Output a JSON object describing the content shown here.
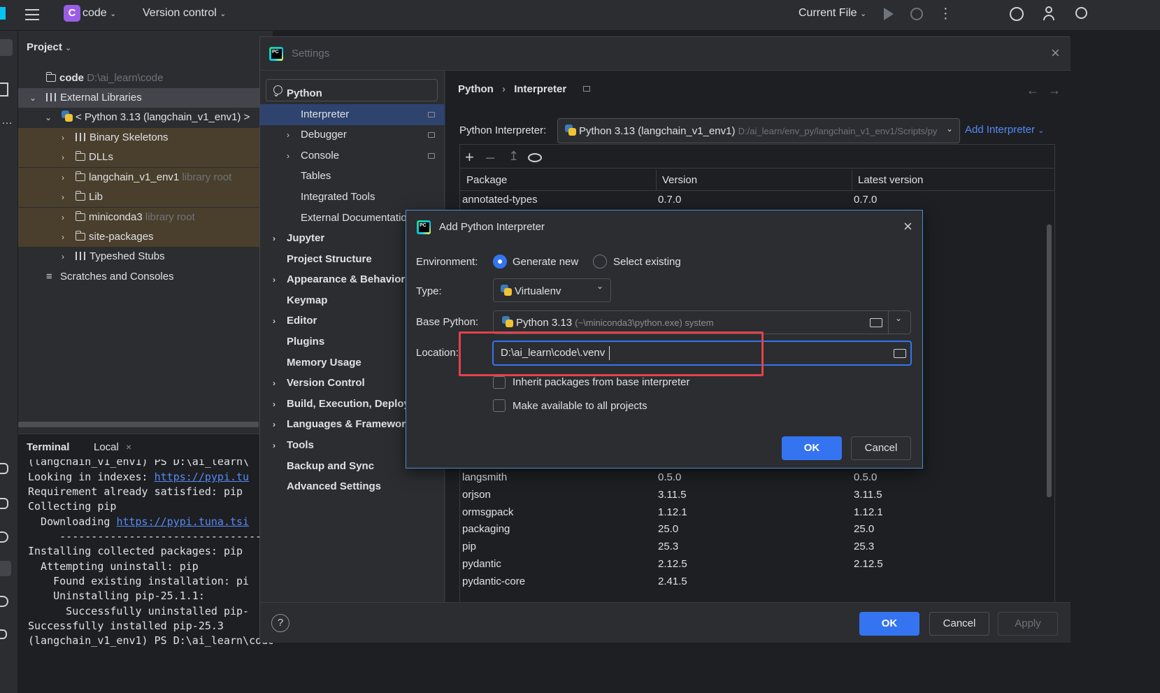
{
  "topbar": {
    "project_letter": "C",
    "project_name": "code",
    "vcs": "Version control",
    "run_config": "Current File"
  },
  "project_panel": {
    "title": "Project",
    "tree": [
      {
        "label": "code",
        "hint": "D:\\ai_learn\\code"
      },
      {
        "label": "External Libraries",
        "hint": ""
      },
      {
        "label": "< Python 3.13 (langchain_v1_env1) >",
        "hint": ""
      },
      {
        "label": "Binary Skeletons",
        "hint": ""
      },
      {
        "label": "DLLs",
        "hint": ""
      },
      {
        "label": "langchain_v1_env1",
        "hint": "library root"
      },
      {
        "label": "Lib",
        "hint": ""
      },
      {
        "label": "miniconda3",
        "hint": "library root"
      },
      {
        "label": "site-packages",
        "hint": ""
      },
      {
        "label": "Typeshed Stubs",
        "hint": ""
      },
      {
        "label": "Scratches and Consoles",
        "hint": ""
      }
    ]
  },
  "terminal": {
    "tab_title": "Terminal",
    "tab_local": "Local",
    "lines": [
      "(langchain_v1_env1) PS D:\\ai_learn\\",
      "Looking in indexes: ",
      "Requirement already satisfied: pip",
      "Collecting pip",
      "  Downloading ",
      "     ---------------------------------",
      "Installing collected packages: pip",
      "  Attempting uninstall: pip",
      "    Found existing installation: pi",
      "    Uninstalling pip-25.1.1:",
      "      Successfully uninstalled pip-",
      "Successfully installed pip-25.3",
      "(langchain_v1_env1) PS D:\\ai_learn\\code> "
    ],
    "link1": "https://pypi.tu",
    "link2": "https://pypi.tuna.tsi"
  },
  "settings": {
    "title": "Settings",
    "search_placeholder": "",
    "nav": [
      {
        "label": "Python",
        "bold": true,
        "arrow": "v"
      },
      {
        "label": "Interpreter",
        "bold": false,
        "arrow": ""
      },
      {
        "label": "Debugger",
        "bold": false,
        "arrow": ">"
      },
      {
        "label": "Console",
        "bold": false,
        "arrow": ">"
      },
      {
        "label": "Tables",
        "bold": false,
        "arrow": ""
      },
      {
        "label": "Integrated Tools",
        "bold": false,
        "arrow": ""
      },
      {
        "label": "External Documentation",
        "bold": false,
        "arrow": ""
      },
      {
        "label": "Jupyter",
        "bold": true,
        "arrow": ">"
      },
      {
        "label": "Project Structure",
        "bold": true,
        "arrow": ""
      },
      {
        "label": "Appearance & Behavior",
        "bold": true,
        "arrow": ">"
      },
      {
        "label": "Keymap",
        "bold": true,
        "arrow": ""
      },
      {
        "label": "Editor",
        "bold": true,
        "arrow": ">"
      },
      {
        "label": "Plugins",
        "bold": true,
        "arrow": ""
      },
      {
        "label": "Memory Usage",
        "bold": true,
        "arrow": ""
      },
      {
        "label": "Version Control",
        "bold": true,
        "arrow": ">"
      },
      {
        "label": "Build, Execution, Deployment",
        "bold": true,
        "arrow": ">"
      },
      {
        "label": "Languages & Frameworks",
        "bold": true,
        "arrow": ">"
      },
      {
        "label": "Tools",
        "bold": true,
        "arrow": ">"
      },
      {
        "label": "Backup and Sync",
        "bold": true,
        "arrow": ""
      },
      {
        "label": "Advanced Settings",
        "bold": true,
        "arrow": ""
      }
    ],
    "breadcrumb_parent": "Python",
    "breadcrumb_sep": "›",
    "breadcrumb_current": "Interpreter",
    "interpreter_label": "Python Interpreter:",
    "interpreter_value": "Python 3.13 (langchain_v1_env1)",
    "interpreter_path": "D:/ai_learn/env_py/langchain_v1_env1/Scripts/py",
    "add_interpreter": "Add Interpreter",
    "columns": [
      "Package",
      "Version",
      "Latest version"
    ],
    "packages_top": [
      {
        "name": "annotated-types",
        "version": "0.7.0",
        "latest": "0.7.0"
      }
    ],
    "packages": [
      {
        "name": "langsmith",
        "version": "0.5.0",
        "latest": "0.5.0"
      },
      {
        "name": "orjson",
        "version": "3.11.5",
        "latest": "3.11.5"
      },
      {
        "name": "ormsgpack",
        "version": "1.12.1",
        "latest": "1.12.1"
      },
      {
        "name": "packaging",
        "version": "25.0",
        "latest": "25.0"
      },
      {
        "name": "pip",
        "version": "25.3",
        "latest": "25.3"
      },
      {
        "name": "pydantic",
        "version": "2.12.5",
        "latest": "2.12.5"
      },
      {
        "name": "pydantic-core",
        "version": "2.41.5",
        "latest": ""
      }
    ],
    "ok": "OK",
    "cancel": "Cancel",
    "apply": "Apply",
    "help": "?"
  },
  "add_interpreter": {
    "title": "Add Python Interpreter",
    "environment_label": "Environment:",
    "opt_generate": "Generate new",
    "opt_select": "Select existing",
    "type_label": "Type:",
    "type_value": "Virtualenv",
    "base_label": "Base Python:",
    "base_value": "Python 3.13",
    "base_hint": "(~\\miniconda3\\python.exe) system",
    "location_label": "Location:",
    "location_value": "D:\\ai_learn\\code\\.venv",
    "inherit": "Inherit packages from base interpreter",
    "make_available": "Make available to all projects",
    "ok": "OK",
    "cancel": "Cancel"
  },
  "colors": {
    "accent": "#3574f0",
    "highlight_box": "#e0434b"
  }
}
